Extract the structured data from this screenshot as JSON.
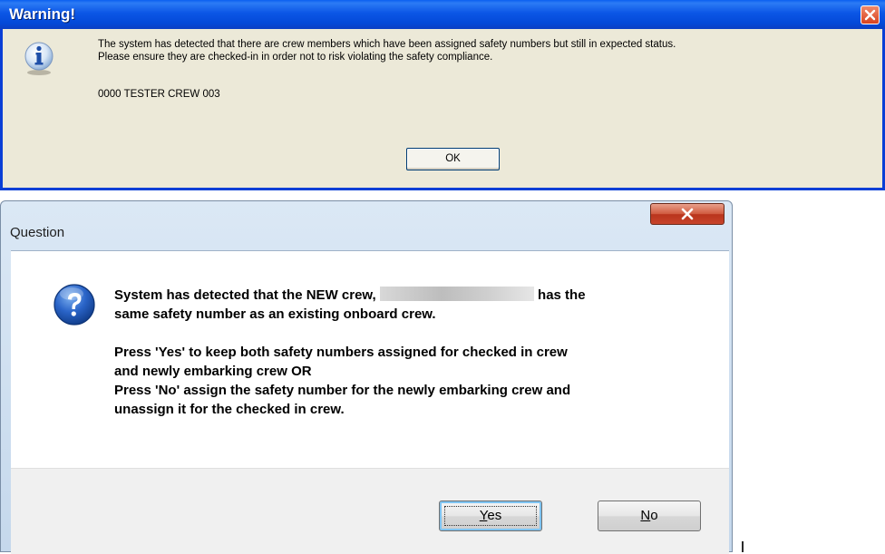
{
  "warning_dialog": {
    "title": "Warning!",
    "message_line1": "The system has detected that there are crew members which have been assigned safety numbers but still in expected status.",
    "message_line2": "Please ensure they are checked-in in order not to risk violating the safety compliance.",
    "crew_entry": "0000 TESTER CREW 003",
    "ok_label": "OK",
    "icon": "info-icon",
    "close_icon": "close-icon",
    "titlebar_color": "#0a4fe0",
    "body_color": "#ece9d8"
  },
  "question_dialog": {
    "title": "Question",
    "message_part1_before": "System has detected that the NEW crew,",
    "message_part1_after": "has the",
    "message_part1_line2": "same safety number as an existing onboard crew.",
    "message_part2_line1": "Press 'Yes' to keep both safety numbers assigned for checked in crew",
    "message_part2_line2": "and newly embarking crew OR",
    "message_part2_line3": "Press 'No' assign the safety number for the newly embarking crew and",
    "message_part2_line4": "unassign it for the checked in crew.",
    "yes_label_mnemonic": "Y",
    "yes_label_rest": "es",
    "no_label_mnemonic": "N",
    "no_label_rest": "o",
    "icon": "question-icon",
    "close_icon": "close-icon"
  }
}
